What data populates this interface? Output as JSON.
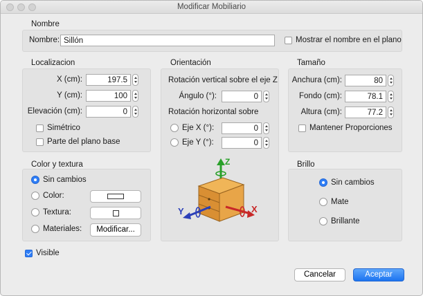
{
  "window": {
    "title": "Modificar Mobiliario"
  },
  "name_section": {
    "title": "Nombre",
    "label": "Nombre:",
    "value": "Sillón",
    "show_name_checkbox": "Mostrar el nombre en el plano"
  },
  "location": {
    "title": "Localizacion",
    "x_label": "X (cm):",
    "x_value": "197.5",
    "y_label": "Y (cm):",
    "y_value": "100",
    "elevation_label": "Elevación (cm):",
    "elevation_value": "0",
    "mirrored_label": "Simétrico",
    "base_plan_label": "Parte del plano base"
  },
  "orientation": {
    "title": "Orientación",
    "vertical_label": "Rotación vertical sobre el eje Z",
    "angle_label": "Ángulo (°):",
    "angle_value": "0",
    "horizontal_label": "Rotación horizontal sobre",
    "axis_x_label": "Eje X (°):",
    "axis_x_value": "0",
    "axis_y_label": "Eje Y (°):",
    "axis_y_value": "0",
    "axis_letters": {
      "z": "Z",
      "y": "Y",
      "x": "X"
    }
  },
  "size": {
    "title": "Tamaño",
    "width_label": "Anchura (cm):",
    "width_value": "80",
    "depth_label": "Fondo (cm):",
    "depth_value": "78.1",
    "height_label": "Altura (cm):",
    "height_value": "77.2",
    "keep_proportions_label": "Mantener Proporciones"
  },
  "color_texture": {
    "title": "Color y textura",
    "no_change": "Sin cambios",
    "color": "Color:",
    "texture": "Textura:",
    "materials": "Materiales:",
    "modify_button": "Modificar..."
  },
  "brightness": {
    "title": "Brillo",
    "no_change": "Sin cambios",
    "matte": "Mate",
    "glossy": "Brillante"
  },
  "visible_label": "Visible",
  "buttons": {
    "cancel": "Cancelar",
    "accept": "Aceptar"
  },
  "colors": {
    "accent": "#2f7ef6",
    "panel": "#e3e3e3",
    "window": "#ececec"
  }
}
